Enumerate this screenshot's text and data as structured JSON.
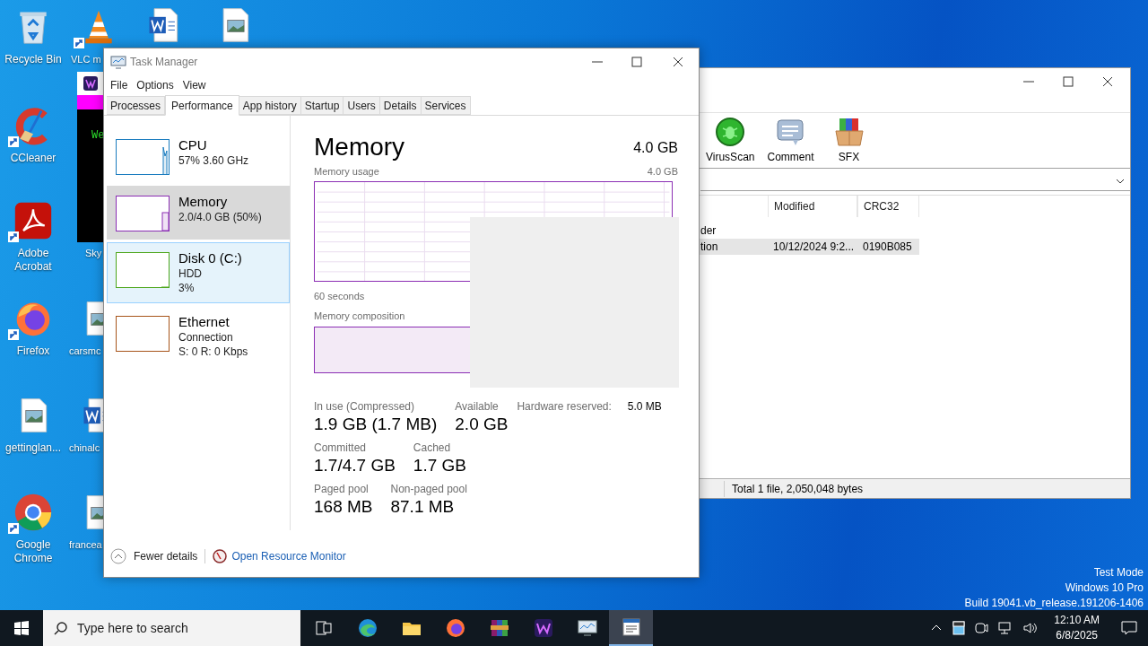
{
  "desktop_icons": [
    {
      "label": "Recycle Bin",
      "kind": "recycle",
      "shortcut": false
    },
    {
      "label": "VLC m",
      "kind": "vlc",
      "shortcut": true
    },
    {
      "kind": "word",
      "shortcut": false
    },
    {
      "kind": "image",
      "shortcut": false
    },
    {
      "label": "CCleaner",
      "kind": "ccleaner",
      "shortcut": true
    },
    {
      "label": "Adobe Acrobat",
      "kind": "acrobat",
      "shortcut": true
    },
    {
      "label": "Sky"
    },
    {
      "label": "Firefox",
      "kind": "firefox",
      "shortcut": true
    },
    {
      "label": "carsmc",
      "kind": "image",
      "shortcut": false
    },
    {
      "label": "gettinglan...",
      "kind": "image",
      "shortcut": false
    },
    {
      "label": "chinalc",
      "kind": "word",
      "shortcut": false
    },
    {
      "label": "Google Chrome",
      "kind": "chrome",
      "shortcut": true
    },
    {
      "label": "francea",
      "kind": "image",
      "shortcut": false
    }
  ],
  "terminal_window": {
    "text": "We"
  },
  "archive_window": {
    "toolbar": [
      "VirusScan",
      "Comment",
      "SFX"
    ],
    "columns": [
      "Modified",
      "CRC32"
    ],
    "rows": [
      {
        "name": "der",
        "selected": false
      },
      {
        "name": "tion",
        "modified": "10/12/2024 9:2...",
        "crc32": "0190B085",
        "selected": true
      }
    ],
    "status_bar": "Total 1 file, 2,050,048 bytes"
  },
  "task_manager": {
    "title": "Task Manager",
    "menu": [
      "File",
      "Options",
      "View"
    ],
    "tabs": [
      {
        "label": "Processes",
        "selected": false
      },
      {
        "label": "Performance",
        "selected": true
      },
      {
        "label": "App history",
        "selected": false
      },
      {
        "label": "Startup",
        "selected": false
      },
      {
        "label": "Users",
        "selected": false
      },
      {
        "label": "Details",
        "selected": false
      },
      {
        "label": "Services",
        "selected": false
      }
    ],
    "sidebar": [
      {
        "name": "CPU",
        "lines": [
          "57% 3.60 GHz"
        ],
        "color": "#1a7cbf",
        "selected": false,
        "hovered": false
      },
      {
        "name": "Memory",
        "lines": [
          "2.0/4.0 GB (50%)"
        ],
        "color": "#8b2eb4",
        "selected": true,
        "hovered": false
      },
      {
        "name": "Disk 0 (C:)",
        "lines": [
          "HDD",
          "3%"
        ],
        "color": "#4da61b",
        "selected": false,
        "hovered": true
      },
      {
        "name": "Ethernet",
        "lines": [
          "Connection",
          "S: 0 R: 0 Kbps"
        ],
        "color": "#a7541a",
        "selected": false,
        "hovered": false
      }
    ],
    "panel": {
      "title": "Memory",
      "total": "4.0 GB",
      "usage_label": "Memory usage",
      "usage_max": "4.0 GB",
      "time_span": "60 seconds",
      "composition_label": "Memory composition",
      "stats": [
        [
          {
            "label": "In use (Compressed)",
            "value": "1.9 GB (1.7 MB)"
          },
          {
            "label": "Available",
            "value": "2.0 GB"
          }
        ],
        [
          {
            "label": "Committed",
            "value": "1.7/4.7 GB"
          },
          {
            "label": "Cached",
            "value": "1.7 GB"
          }
        ],
        [
          {
            "label": "Paged pool",
            "value": "168 MB"
          },
          {
            "label": "Non-paged pool",
            "value": "87.1 MB"
          }
        ]
      ],
      "hardware_reserved": {
        "label": "Hardware reserved:",
        "value": "5.0 MB"
      }
    },
    "footer": {
      "fewer_details": "Fewer details",
      "resource_monitor": "Open Resource Monitor"
    }
  },
  "desktop_text": [
    "Test Mode",
    "Windows 10 Pro",
    "Build 19041.vb_release.191206-1406"
  ],
  "taskbar": {
    "search_placeholder": "Type here to search",
    "apps": [
      {
        "kind": "taskview",
        "active": false
      },
      {
        "kind": "edge",
        "active": false
      },
      {
        "kind": "explorer",
        "active": false
      },
      {
        "kind": "firefox",
        "active": false
      },
      {
        "kind": "winrar",
        "active": false
      },
      {
        "kind": "wp",
        "active": false
      },
      {
        "kind": "taskmgr",
        "active": false
      },
      {
        "kind": "notes",
        "active": true
      }
    ],
    "time": "12:10 AM",
    "date": "6/8/2025"
  }
}
